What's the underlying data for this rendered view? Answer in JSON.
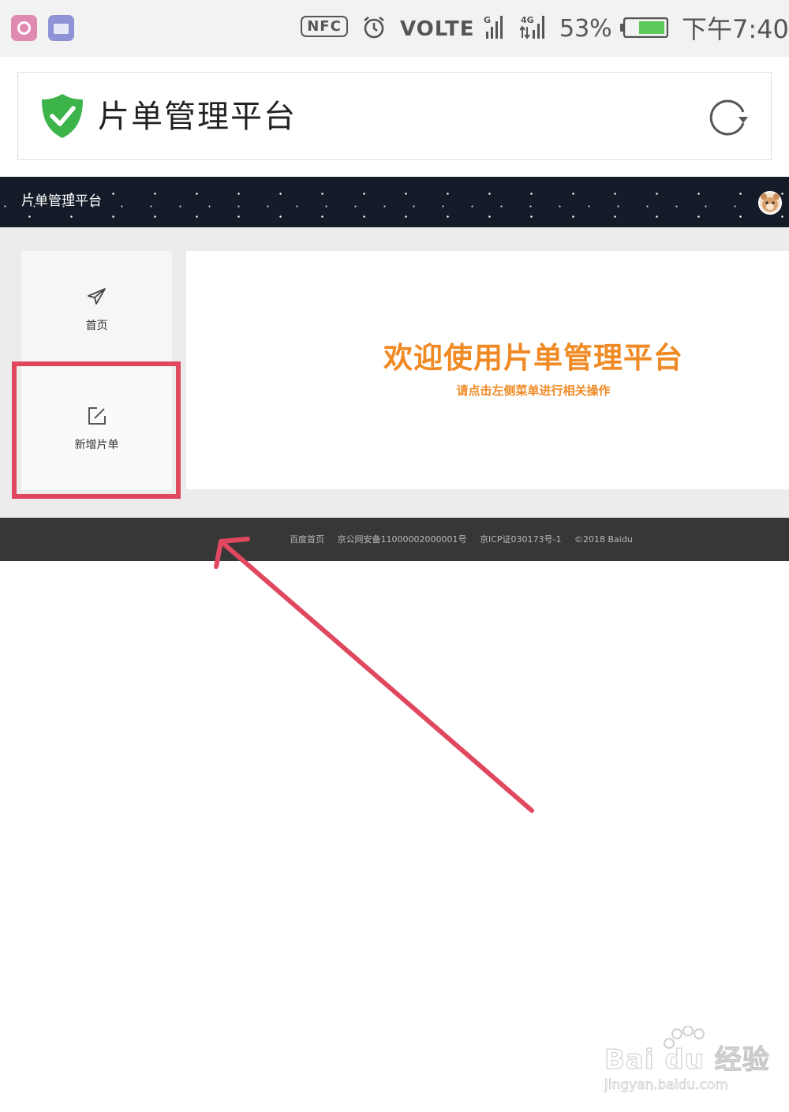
{
  "status_bar": {
    "nfc": "NFC",
    "network": "VOLTE",
    "signal_labels": [
      "G",
      "4G"
    ],
    "battery_percent": "53%",
    "time": "下午7:40",
    "battery_color": "#5ac85a"
  },
  "app_header": {
    "title": "片单管理平台",
    "icons": [
      "shield-check-icon",
      "refresh-icon"
    ],
    "shield_color": "#3cb44a"
  },
  "navbar": {
    "title": "片单管理平台",
    "avatar": "avatar-icon"
  },
  "sidebar": {
    "items": [
      {
        "label": "首页",
        "icon": "paper-plane-icon"
      },
      {
        "label": "新增片单",
        "icon": "edit-icon"
      }
    ],
    "highlight_color": "#e0485f"
  },
  "welcome": {
    "title": "欢迎使用片单管理平台",
    "subtitle": "请点击左侧菜单进行相关操作",
    "color": "#f08a24"
  },
  "footer": {
    "links": [
      "百度首页",
      "京公网安备11000002000001号",
      "京ICP证030173号-1",
      "©2018 Baidu"
    ]
  },
  "watermark": {
    "brand": "Bai du 经验",
    "url": "jingyan.baidu.com"
  }
}
